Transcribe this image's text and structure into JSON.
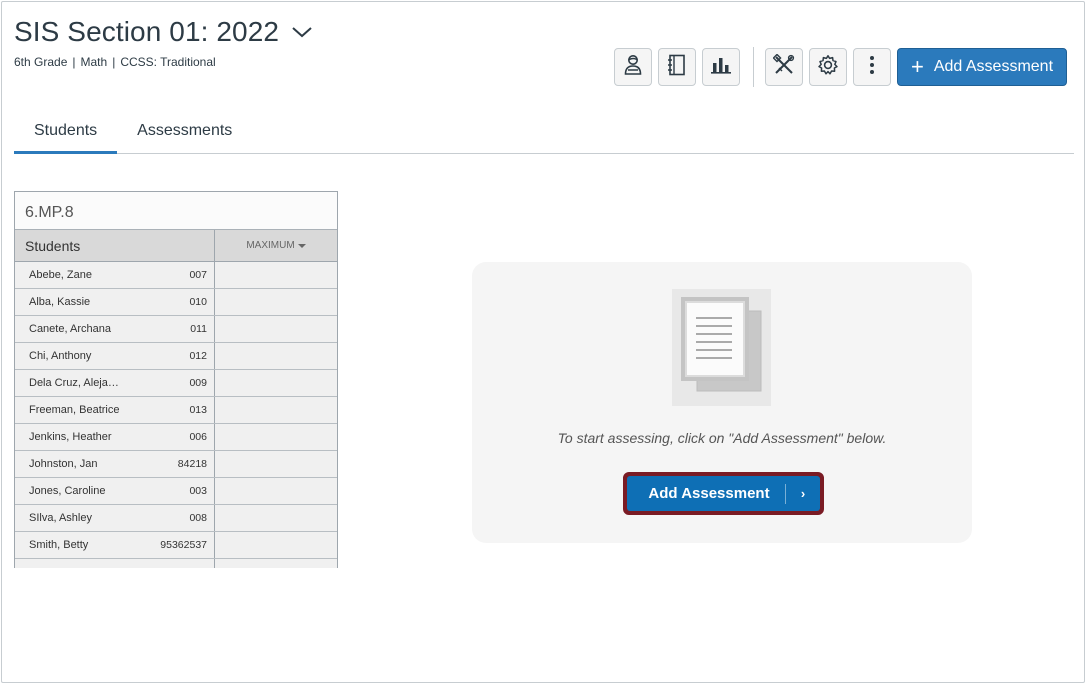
{
  "header": {
    "title": "SIS Section 01: 2022",
    "meta": [
      "6th Grade",
      "Math",
      "CCSS: Traditional"
    ],
    "meta_sep": "|"
  },
  "toolbar": {
    "icons": [
      "student-view-icon",
      "notebook-icon",
      "bar-chart-icon",
      "tools-icon",
      "gear-icon",
      "more-vertical-icon"
    ],
    "add_label": "Add Assessment",
    "add_color": "#2b7abc"
  },
  "tabs": [
    {
      "label": "Students",
      "active": true
    },
    {
      "label": "Assessments",
      "active": false
    }
  ],
  "grid": {
    "standard": "6.MP.8",
    "students_header": "Students",
    "max_header": "MAXIMUM",
    "rows": [
      {
        "name": "Abebe, Zane",
        "id": "007"
      },
      {
        "name": "Alba, Kassie",
        "id": "010"
      },
      {
        "name": "Canete, Archana",
        "id": "011"
      },
      {
        "name": "Chi, Anthony",
        "id": "012"
      },
      {
        "name": "Dela Cruz, Aleja…",
        "id": "009"
      },
      {
        "name": "Freeman, Beatrice",
        "id": "013"
      },
      {
        "name": "Jenkins, Heather",
        "id": "006"
      },
      {
        "name": "Johnston, Jan",
        "id": "84218"
      },
      {
        "name": "Jones, Caroline",
        "id": "003"
      },
      {
        "name": "SIlva, Ashley",
        "id": "008"
      },
      {
        "name": "Smith, Betty",
        "id": "95362537"
      },
      {
        "name": "",
        "id": ""
      }
    ]
  },
  "empty_state": {
    "icon": "documents-icon",
    "message": "To start assessing, click on \"Add Assessment\" below.",
    "cta_label": "Add Assessment",
    "cta_arrow": "›",
    "cta_color": "#0e6fb5",
    "highlight_color": "#7a1b24"
  }
}
